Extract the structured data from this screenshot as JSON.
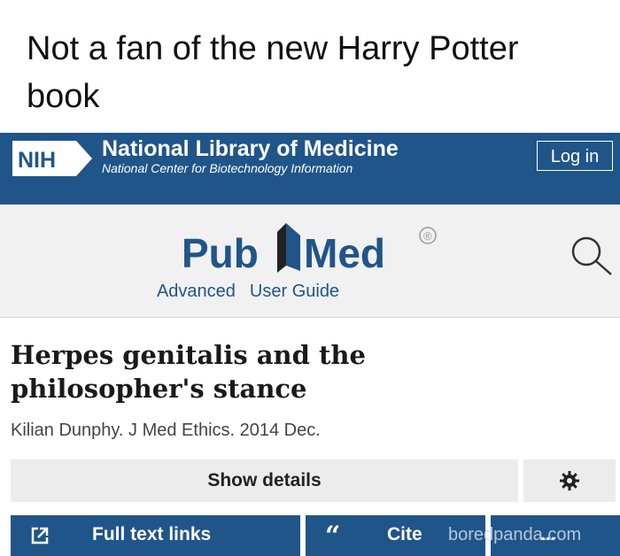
{
  "caption": "Not a fan of the new Harry Potter book",
  "header": {
    "nih_badge": "NIH",
    "library_title": "National Library of Medicine",
    "library_subtitle": "National Center for Biotechnology Information",
    "login_label": "Log in",
    "bar_color": "#20558a"
  },
  "pubmed": {
    "logo_left": "Pub",
    "logo_right": "Med",
    "registered_mark": "®",
    "links": [
      "Advanced",
      "User Guide"
    ],
    "search_icon": "search-icon"
  },
  "article": {
    "title": "Herpes genitalis and the philosopher's stance",
    "authors": "Kilian Dunphy. J Med Ethics. 2014 Dec."
  },
  "actions": {
    "show_details": "Show details",
    "settings_icon": "gear-icon",
    "full_text_links": "Full text links",
    "full_text_icon": "external-link-icon",
    "cite": "Cite",
    "cite_icon": "quote-icon",
    "more": "..."
  },
  "watermark": "boredpanda.com"
}
